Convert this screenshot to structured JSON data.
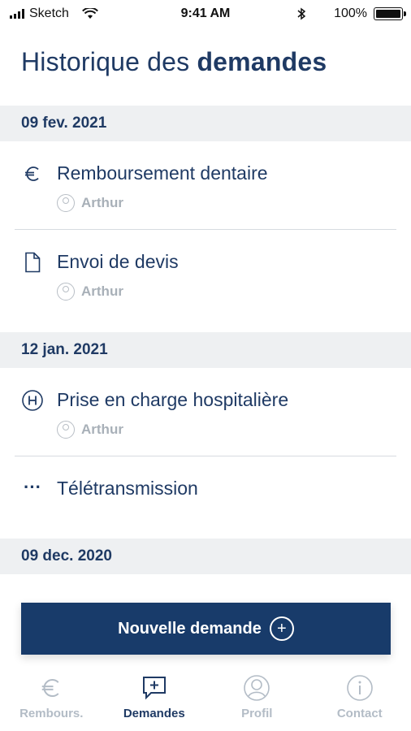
{
  "status_bar": {
    "carrier": "Sketch",
    "time": "9:41 AM",
    "battery": "100%"
  },
  "page": {
    "title_light": "Historique des ",
    "title_bold": "demandes"
  },
  "groups": [
    {
      "date": "09 fev. 2021",
      "items": [
        {
          "icon": "euro-icon",
          "title": "Remboursement dentaire",
          "person": "Arthur"
        },
        {
          "icon": "document-icon",
          "title": "Envoi de devis",
          "person": "Arthur"
        }
      ]
    },
    {
      "date": "12 jan. 2021",
      "items": [
        {
          "icon": "hospital-icon",
          "title": "Prise en charge hospitalière",
          "person": "Arthur"
        },
        {
          "icon": "more-icon",
          "title": "Télétransmission"
        }
      ]
    },
    {
      "date": "09 dec. 2020",
      "items": []
    }
  ],
  "cta": {
    "label": "Nouvelle demande"
  },
  "tabs": [
    {
      "label": "Rembours.",
      "icon": "euro-icon",
      "active": false
    },
    {
      "label": "Demandes",
      "icon": "message-add-icon",
      "active": true
    },
    {
      "label": "Profil",
      "icon": "profile-icon",
      "active": false
    },
    {
      "label": "Contact",
      "icon": "info-icon",
      "active": false
    }
  ],
  "colors": {
    "primary": "#1f3a64",
    "cta": "#183b6a",
    "muted": "#a8b0b8",
    "header_bg": "#eef0f2"
  }
}
